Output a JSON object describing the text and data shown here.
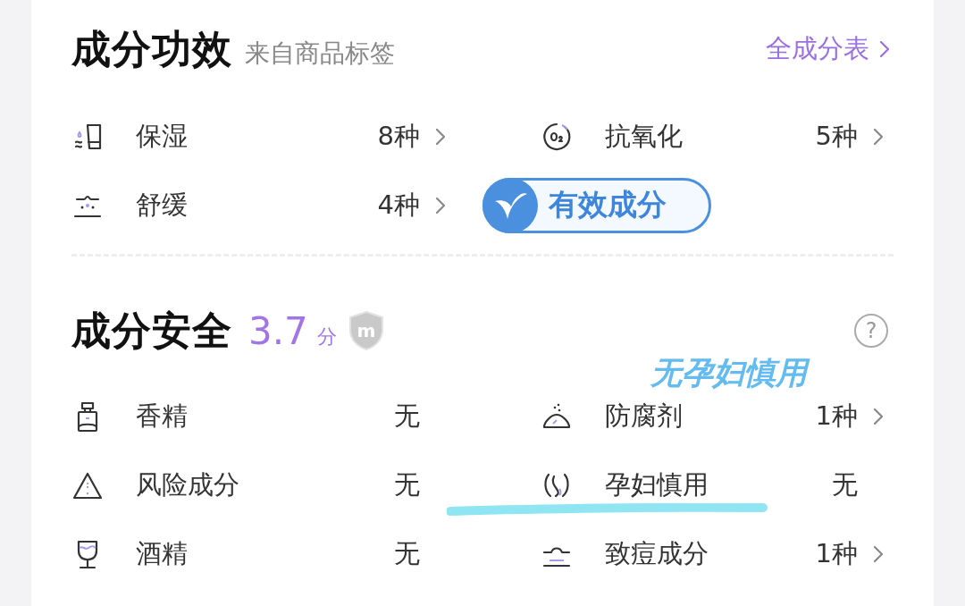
{
  "efficacy": {
    "title": "成分功效",
    "source": "来自商品标签",
    "link": "全成分表",
    "items": [
      {
        "kind": "moisture",
        "label": "保湿",
        "value": "8种",
        "arrow": true
      },
      {
        "kind": "antioxidant",
        "label": "抗氧化",
        "value": "5种",
        "arrow": true
      },
      {
        "kind": "soothing",
        "label": "舒缓",
        "value": "4种",
        "arrow": true
      }
    ],
    "badge": "有效成分"
  },
  "safety": {
    "title": "成分安全",
    "score": "3.7",
    "score_unit": "分",
    "shield_mark": "m",
    "help": "?",
    "annotation": "无孕妇慎用",
    "items": [
      {
        "kind": "fragrance",
        "label": "香精",
        "value": "无",
        "arrow": false,
        "highlighted": false
      },
      {
        "kind": "preservative",
        "label": "防腐剂",
        "value": "1种",
        "arrow": true,
        "highlighted": false
      },
      {
        "kind": "risk",
        "label": "风险成分",
        "value": "无",
        "arrow": false,
        "highlighted": false
      },
      {
        "kind": "pregnancy",
        "label": "孕妇慎用",
        "value": "无",
        "arrow": false,
        "highlighted": true
      },
      {
        "kind": "alcohol",
        "label": "酒精",
        "value": "无",
        "arrow": false,
        "highlighted": false
      },
      {
        "kind": "acne",
        "label": "致痘成分",
        "value": "1种",
        "arrow": true,
        "highlighted": false
      }
    ]
  }
}
